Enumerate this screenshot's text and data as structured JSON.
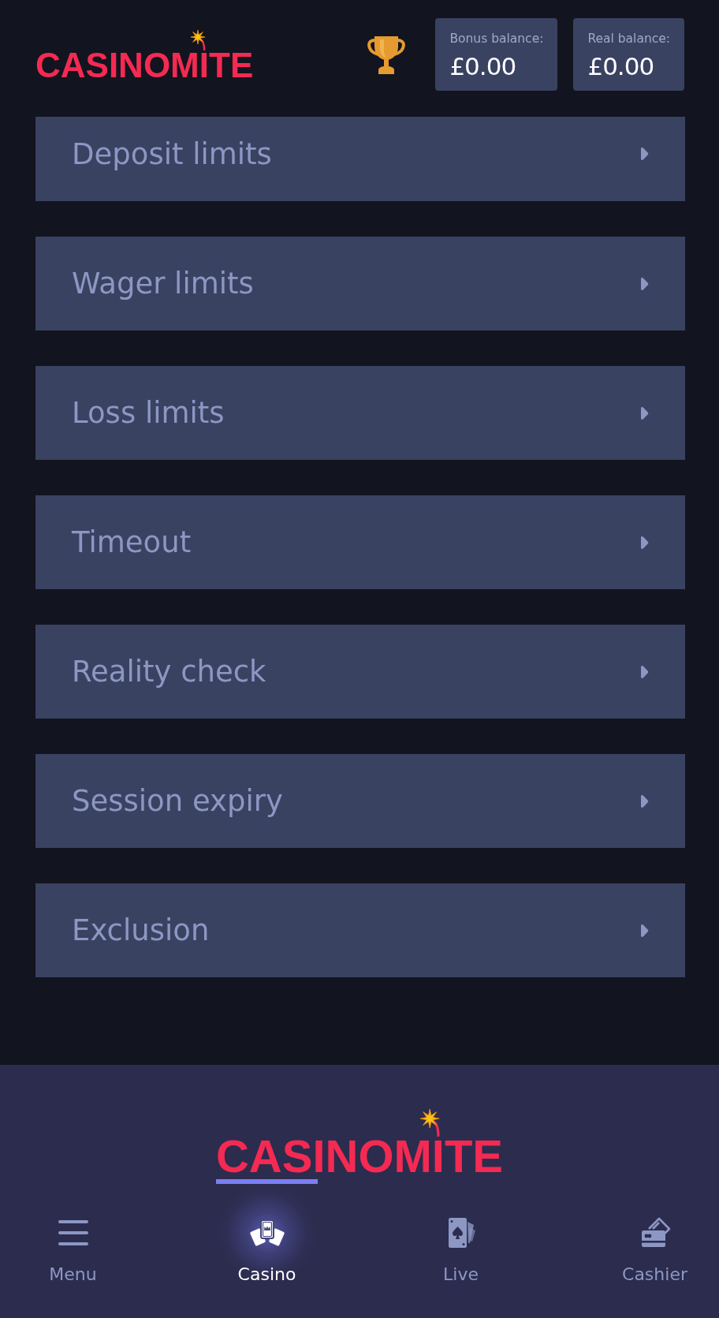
{
  "header": {
    "logo": "CASINOMITE",
    "balances": [
      {
        "label": "Bonus balance:",
        "amount": "£0.00"
      },
      {
        "label": "Real balance:",
        "amount": "£0.00"
      }
    ]
  },
  "limits_menu": [
    {
      "label": "Deposit limits"
    },
    {
      "label": "Wager limits"
    },
    {
      "label": "Loss limits"
    },
    {
      "label": "Timeout"
    },
    {
      "label": "Reality check"
    },
    {
      "label": "Session expiry"
    },
    {
      "label": "Exclusion"
    }
  ],
  "footer": {
    "logo": "CASINOMITE",
    "nav": [
      {
        "label": "Menu",
        "selected": false
      },
      {
        "label": "Casino",
        "selected": true
      },
      {
        "label": "Live",
        "selected": false
      },
      {
        "label": "Cashier",
        "selected": false
      }
    ]
  }
}
